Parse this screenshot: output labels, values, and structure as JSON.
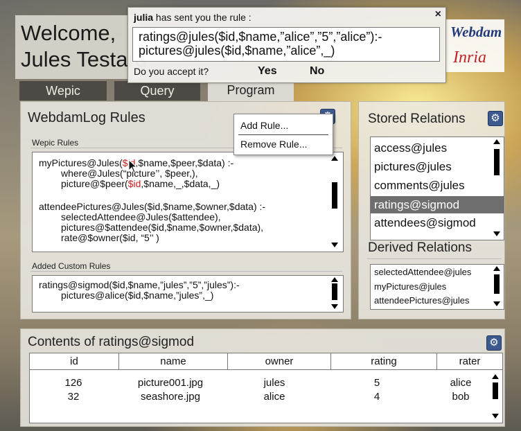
{
  "header": {
    "welcome_line1": "Welcome,",
    "welcome_line2": "Jules Testard"
  },
  "logos": {
    "webdam": "Webdam",
    "inria": "Inria"
  },
  "tabs": [
    "Wepic",
    "Query",
    "Program"
  ],
  "notification": {
    "sender": "julia",
    "message": " has sent you the rule :",
    "close_glyph": "×",
    "rule_line1": "ratings@jules($id,$name,”alice”,”5”,”alice”):-",
    "rule_line2": "pictures@jules($id,$name,”alice”,_)",
    "question": "Do you accept it?",
    "yes_label": "Yes",
    "no_label": "No"
  },
  "rules_panel": {
    "title": "WebdamLog Rules",
    "wepic_rules_label": "Wepic Rules",
    "rule1": {
      "l1_a": "myPictures@Jules(",
      "l1_red": "$id",
      "l1_b": ",$name,$peer,$data) :-",
      "l2": "where@Jules(“picture’’, $peer,),",
      "l3_a": "picture@$peer(",
      "l3_red": "$id",
      "l3_b": ",$name,_,$data,_)"
    },
    "rule2": {
      "l1": "attendeePictures@Jules($id,$name,$owner,$data) :-",
      "l2": "selectedAttendee@Jules($attendee),",
      "l3": "pictures@$attendee($id,$name,$owner,$data),",
      "l4": "rate@$owner($id, “5’’ )"
    },
    "custom_rules_label": "Added Custom Rules",
    "custom_rule_l1": "ratings@sigmod($id,$name,”jules”,”5”,”jules”):-",
    "custom_rule_l2": "pictures@alice($id,$name,”jules”,_)",
    "menu": [
      "Add Rule...",
      "Remove Rule..."
    ]
  },
  "stored_panel": {
    "title": "Stored Relations",
    "items": [
      "access@jules",
      "pictures@jules",
      "comments@jules",
      "ratings@sigmod",
      "attendees@sigmod"
    ],
    "selected_index": 3,
    "derived_title": "Derived Relations",
    "derived_items": [
      "selectedAttendee@jules",
      "myPictures@jules",
      "attendeePictures@jules"
    ]
  },
  "contents_panel": {
    "title": "Contents of ratings@sigmod",
    "columns": [
      "id",
      "name",
      "owner",
      "rating",
      "rater"
    ],
    "rows": [
      [
        "126",
        "picture001.jpg",
        "jules",
        "5",
        "alice"
      ],
      [
        "32",
        "seashore.jpg",
        "alice",
        "4",
        "bob"
      ]
    ]
  },
  "colors": {
    "gear_blue": "#3d5a8f",
    "selected_row": "#6e6e6e",
    "rule_highlight": "#d21c1c",
    "dark_tab": "#4d4a45"
  },
  "icons": {
    "gear": "⚙",
    "cursor": "arrow-cursor"
  }
}
